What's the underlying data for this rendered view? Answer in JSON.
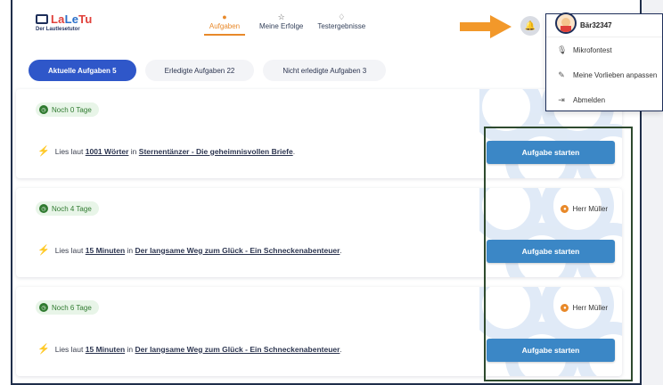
{
  "header": {
    "logo_text_a": "La",
    "logo_text_b": "Le",
    "logo_text_c": "Tu",
    "logo_sub": "Der Lautlesetutor",
    "nav": [
      {
        "label": "Aufgaben",
        "icon": "task-icon",
        "active": true
      },
      {
        "label": "Meine Erfolge",
        "icon": "star-icon",
        "active": false
      },
      {
        "label": "Testergebnisse",
        "icon": "ribbon-icon",
        "active": false
      }
    ]
  },
  "tabs": [
    {
      "label": "Aktuelle Aufgaben 5",
      "active": true
    },
    {
      "label": "Erledigte Aufgaben 22",
      "active": false
    },
    {
      "label": "Nicht erledigte Aufgaben 3",
      "active": false
    }
  ],
  "tasks": [
    {
      "due": "Noch 0 Tage",
      "teacher": "",
      "prefix": "Lies laut",
      "amount": "1001 Wörter",
      "middle": "in",
      "title": "Sternentänzer - Die geheimnisvollen Briefe",
      "suffix": ".",
      "button": "Aufgabe starten"
    },
    {
      "due": "Noch 4 Tage",
      "teacher": "Herr Müller",
      "prefix": "Lies laut",
      "amount": "15 Minuten",
      "middle": "in",
      "title": "Der langsame Weg zum Glück - Ein Schneckenabenteuer",
      "suffix": ".",
      "button": "Aufgabe starten"
    },
    {
      "due": "Noch 6 Tage",
      "teacher": "Herr Müller",
      "prefix": "Lies laut",
      "amount": "15 Minuten",
      "middle": "in",
      "title": "Der langsame Weg zum Glück - Ein Schneckenabenteuer",
      "suffix": ".",
      "button": "Aufgabe starten"
    }
  ],
  "user_menu": {
    "username": "Bär32347",
    "items": [
      {
        "label": "Mikrofontest",
        "icon": "microphone-icon"
      },
      {
        "label": "Meine Vorlieben anpassen",
        "icon": "preferences-icon"
      },
      {
        "label": "Abmelden",
        "icon": "logout-icon"
      }
    ]
  },
  "colors": {
    "accent": "#e8892a",
    "primary": "#2f57c9",
    "button": "#3b87c6",
    "badge_bg": "#e8f5e8",
    "badge_fg": "#2f7a2f"
  }
}
